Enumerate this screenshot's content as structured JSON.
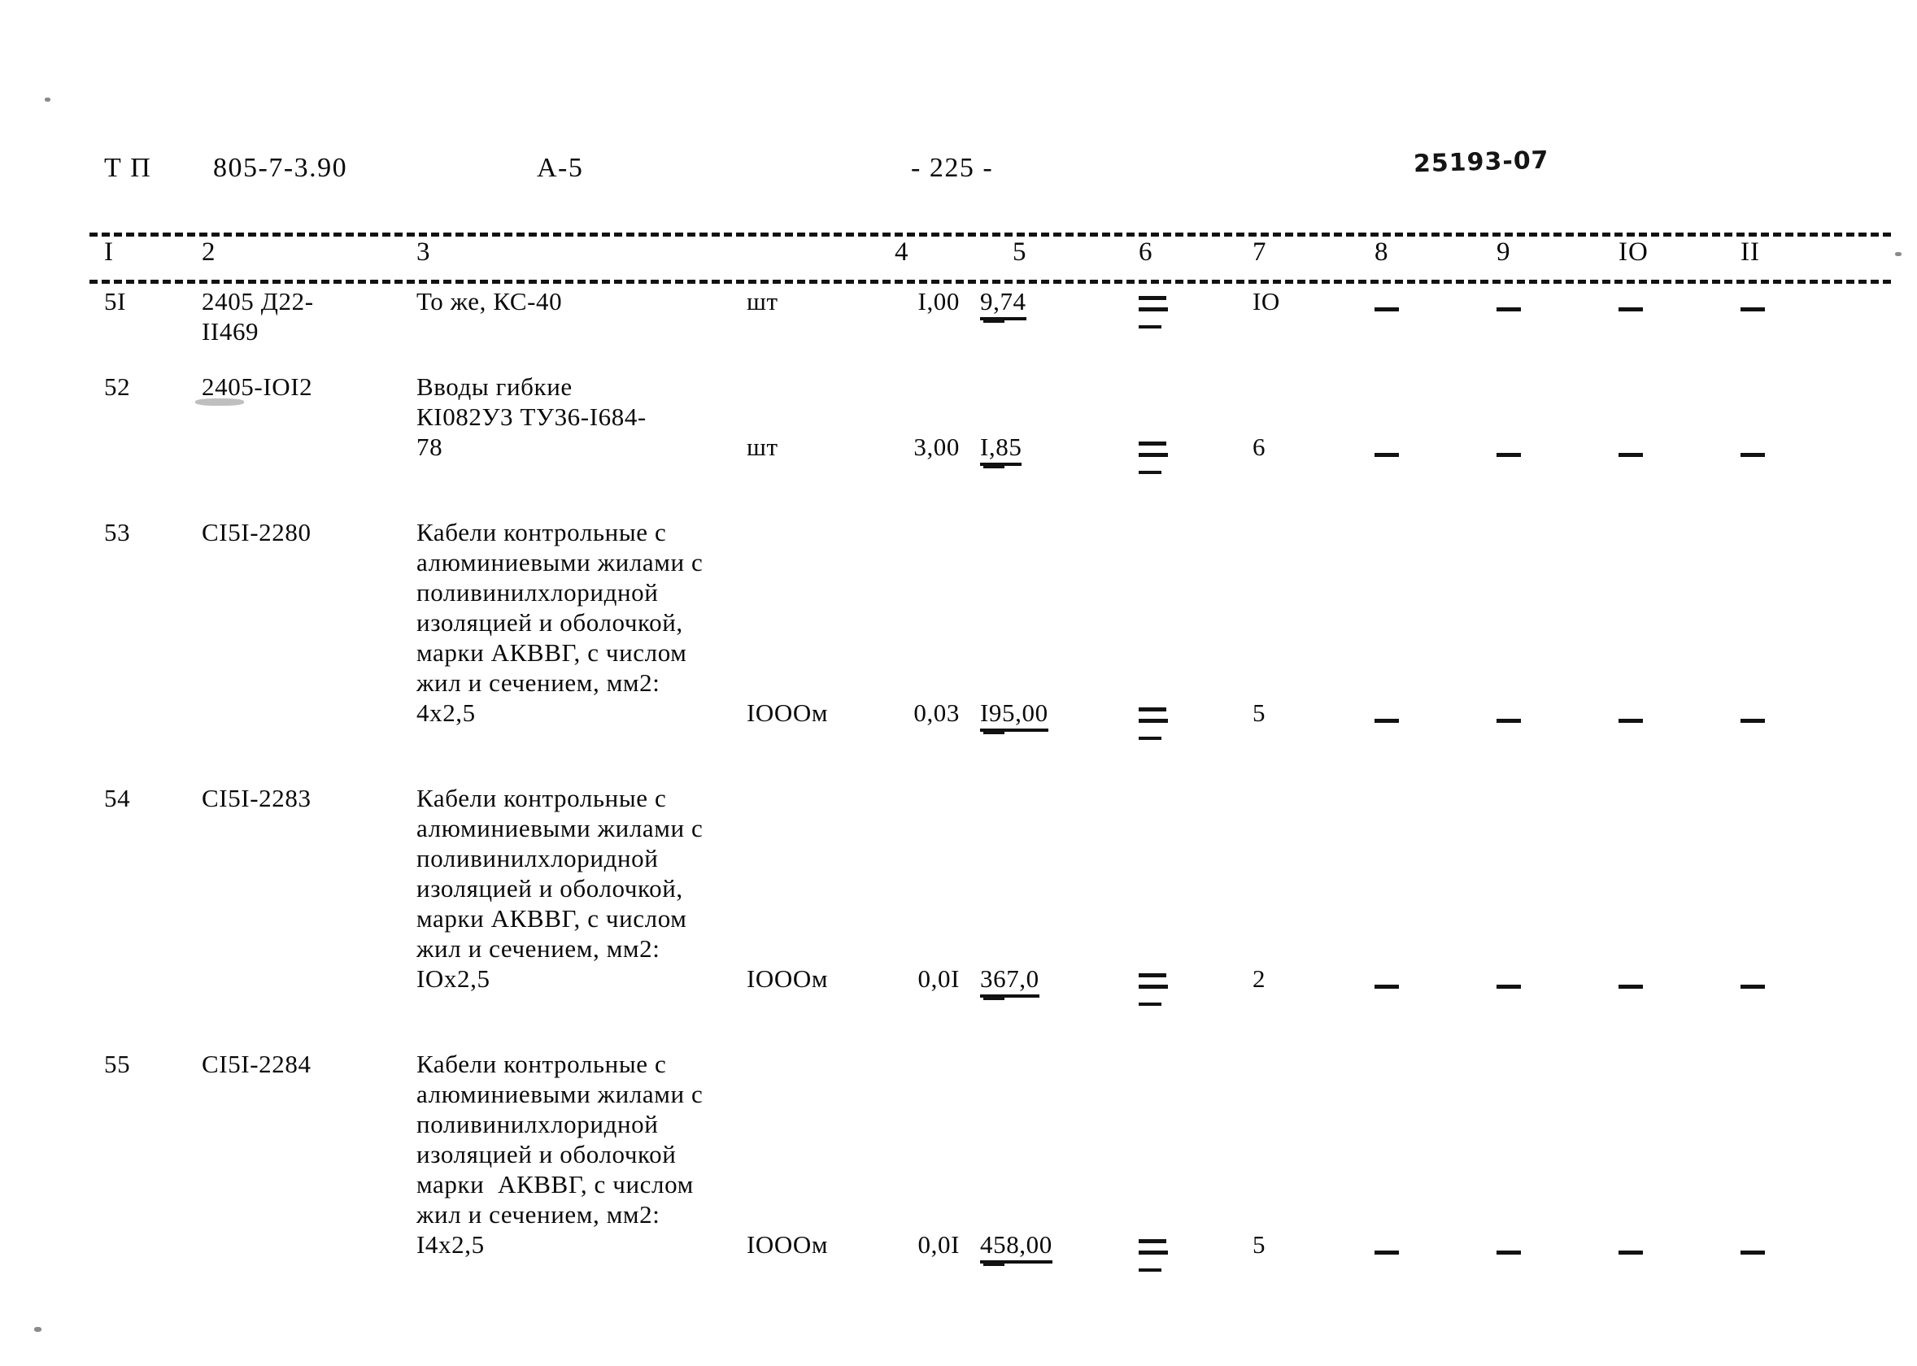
{
  "document": {
    "series_label": "Т П",
    "code": "805-7-3.90",
    "album": "А-5",
    "page_marker": "- 225 -",
    "handwritten_stamp": "25193-07"
  },
  "table": {
    "column_numbers": [
      "I",
      "2",
      "3",
      "4",
      "5",
      "6",
      "7",
      "8",
      "9",
      "IO",
      "II"
    ],
    "rows": [
      {
        "num": "5I",
        "code": "2405 Д22-\nII469",
        "description": "То же, КС-40",
        "unit": "шт",
        "qty": "I,00",
        "price": "9,74",
        "col6": "dash-double",
        "col7": "IO",
        "col8": "-",
        "col9": "-",
        "col10": "-",
        "col11": "-"
      },
      {
        "num": "52",
        "code": "2405-IOI2",
        "description": "Вводы гибкие\nКI082У3 ТУ36-I684-\n78",
        "unit": "шт",
        "qty": "3,00",
        "price": "I,85",
        "col6": "dash-double",
        "col7": "6",
        "col8": "-",
        "col9": "-",
        "col10": "-",
        "col11": "-"
      },
      {
        "num": "53",
        "code": "СI5I-2280",
        "description": "Кабели контрольные с\nалюминиевыми жилами с\nполивинилхлоридной\nизоляцией и оболочкой,\nмарки АКВВГ, с числом\nжил и сечением, мм2:\n4х2,5",
        "unit": "IOOOм",
        "qty": "0,03",
        "price": "I95,00",
        "col6": "dash-double",
        "col7": "5",
        "col8": "-",
        "col9": "-",
        "col10": "-",
        "col11": "-"
      },
      {
        "num": "54",
        "code": "СI5I-2283",
        "description": "Кабели контрольные с\nалюминиевыми жилами с\nполивинилхлоридной\nизоляцией и оболочкой,\nмарки АКВВГ, с числом\nжил и сечением, мм2:\nIOx2,5",
        "unit": "IOOOм",
        "qty": "0,0I",
        "price": "367,0",
        "col6": "dash-double",
        "col7": "2",
        "col8": "-",
        "col9": "-",
        "col10": "-",
        "col11": "-"
      },
      {
        "num": "55",
        "code": "СI5I-2284",
        "description": "Кабели контрольные с\nалюминиевыми жилами с\nполивинилхлоридной\nизоляцией и оболочкой\nмарки  АКВВГ, с числом\nжил и сечением, мм2:\nI4х2,5",
        "unit": "IOOOм",
        "qty": "0,0I",
        "price": "458,00",
        "col6": "dash-double",
        "col7": "5",
        "col8": "-",
        "col9": "-",
        "col10": "-",
        "col11": "-"
      }
    ]
  }
}
